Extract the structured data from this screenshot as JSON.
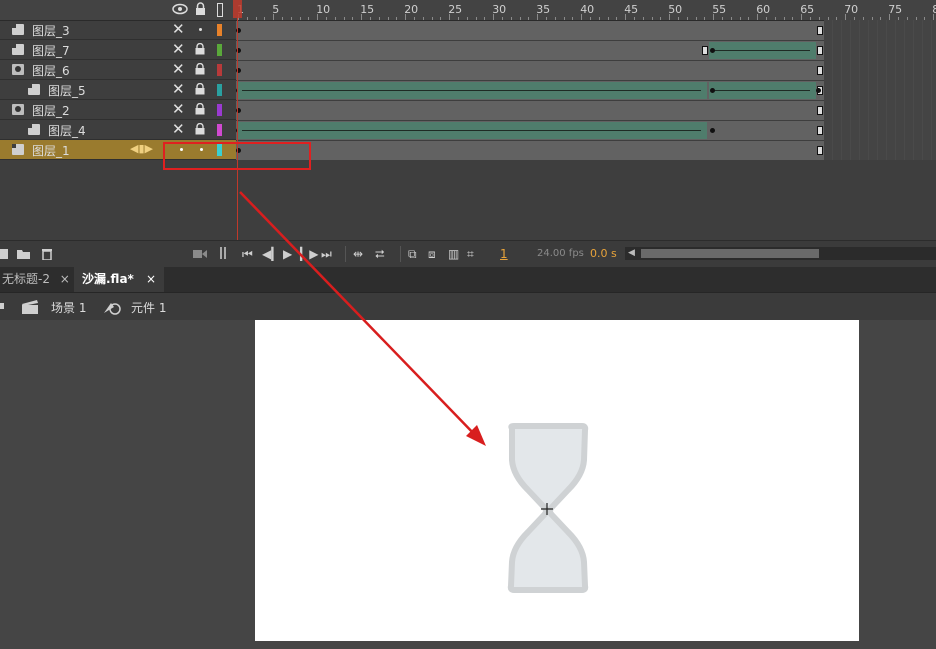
{
  "layers": [
    {
      "name": "图层_3",
      "type": "plain",
      "indent": false,
      "color": "#e8822a",
      "selected": false
    },
    {
      "name": "图层_7",
      "type": "plain",
      "indent": false,
      "color": "#5aa83a",
      "selected": false
    },
    {
      "name": "图层_6",
      "type": "mask",
      "indent": false,
      "color": "#b83a3a",
      "selected": false
    },
    {
      "name": "图层_5",
      "type": "masked",
      "indent": true,
      "color": "#2aa0a0",
      "selected": false
    },
    {
      "name": "图层_2",
      "type": "mask",
      "indent": false,
      "color": "#9a3ad0",
      "selected": false
    },
    {
      "name": "图层_4",
      "type": "masked",
      "indent": true,
      "color": "#d04ad0",
      "selected": false
    },
    {
      "name": "图层_1",
      "type": "plain",
      "indent": false,
      "color": "#3ad0d0",
      "selected": true
    }
  ],
  "ruler_numbers": [
    "1",
    "5",
    "10",
    "15",
    "20",
    "25",
    "30",
    "35",
    "40",
    "45",
    "50",
    "55",
    "60",
    "65",
    "70",
    "75",
    "8"
  ],
  "timeline_controls": {
    "current_frame": "1",
    "fps": "24.00 fps",
    "time": "0.0 s"
  },
  "tabs": [
    {
      "label": "无标题-2",
      "close": "×",
      "active": false
    },
    {
      "label": "沙漏.fla*",
      "close": "×",
      "active": true
    }
  ],
  "breadcrumbs": {
    "scene": "场景 1",
    "symbol": "元件 1"
  },
  "colors": {
    "highlight_box": "#e02020",
    "arrow": "#d81e1e",
    "playhead": "#c0392b",
    "tween": "#4f7d6c"
  },
  "icons": {
    "eye": "eye-icon",
    "lock": "lock-icon",
    "outline": "outline-icon",
    "new_layer": "new-layer-icon",
    "new_folder": "new-folder-icon",
    "delete": "trash-icon"
  }
}
